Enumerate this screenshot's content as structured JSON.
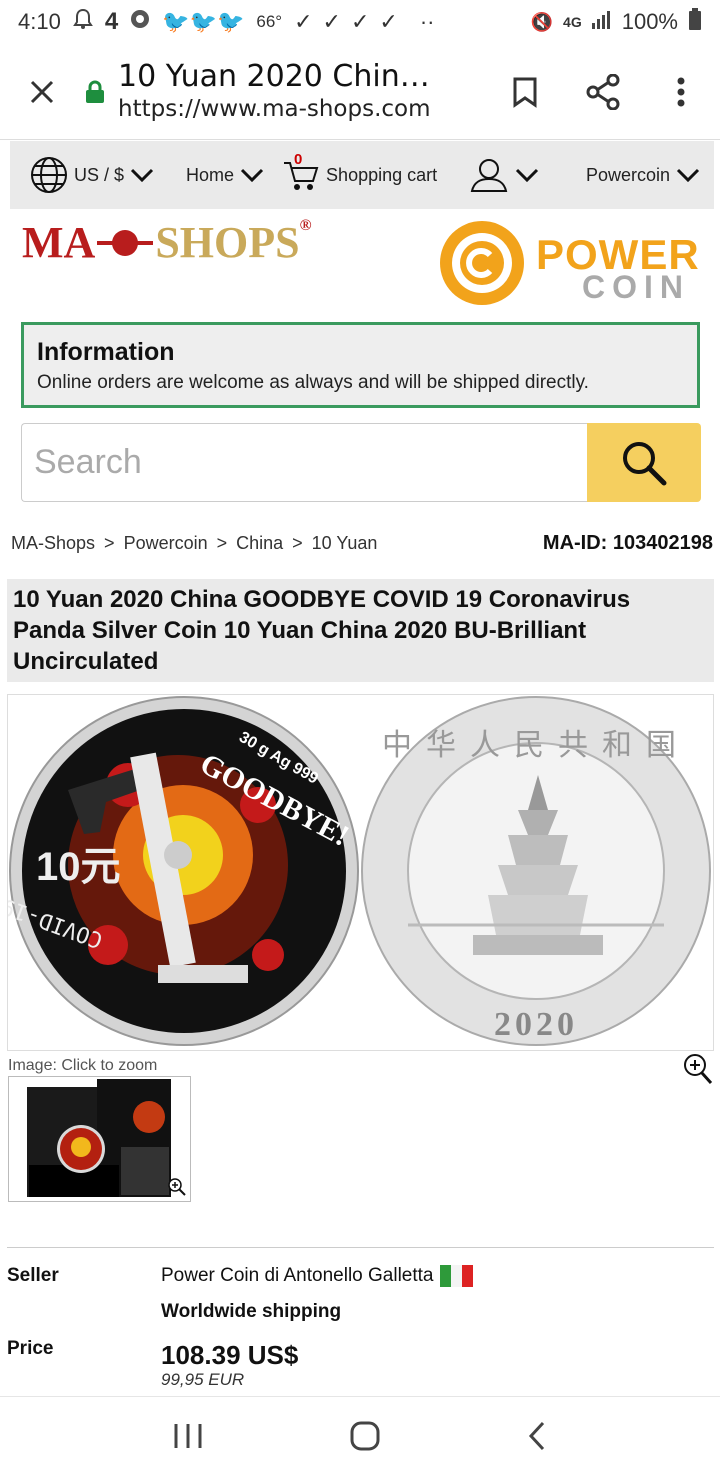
{
  "status_bar": {
    "time": "4:10",
    "weather_temp": "66°",
    "network": "4G",
    "battery": "100%"
  },
  "url_bar": {
    "title": "10 Yuan 2020 Chin…",
    "url": "https://www.ma-shops.com"
  },
  "site_nav": {
    "currency": "US / $",
    "home": "Home",
    "cart": "Shopping cart",
    "cart_count": "0",
    "shop": "Powercoin"
  },
  "logos": {
    "mashops": "MA",
    "mashops2": "SHOPS",
    "powercoin1": "POWER",
    "powercoin2": "COIN"
  },
  "info": {
    "heading": "Information",
    "text": "Online orders are welcome as always and will be shipped directly."
  },
  "search": {
    "placeholder": "Search"
  },
  "breadcrumb": [
    "MA-Shops",
    "Powercoin",
    "China",
    "10 Yuan"
  ],
  "ma_id": "MA-ID: 103402198",
  "product": {
    "title": "10 Yuan 2020 China GOODBYE COVID 19 Coronavirus Panda Silver Coin 10 Yuan China 2020 BU-Brilliant Uncirculated",
    "zoom_text": "Image: Click to zoom",
    "coin_left": {
      "text1": "GOODBYE!",
      "text2": "30 g Ag 999",
      "value": "10元",
      "covid": "COVID-19"
    },
    "coin_right": {
      "chars": "中华人民共和国",
      "year": "2020"
    }
  },
  "seller": {
    "label": "Seller",
    "name": "Power Coin di Antonello Galletta",
    "shipping": "Worldwide shipping"
  },
  "price": {
    "label": "Price",
    "usd": "108.39 US$",
    "eur": "99,95 EUR"
  },
  "colors": {
    "accent": "#f5cf5f",
    "info_border": "#3a9a5e",
    "lock": "#1e8e3e"
  }
}
